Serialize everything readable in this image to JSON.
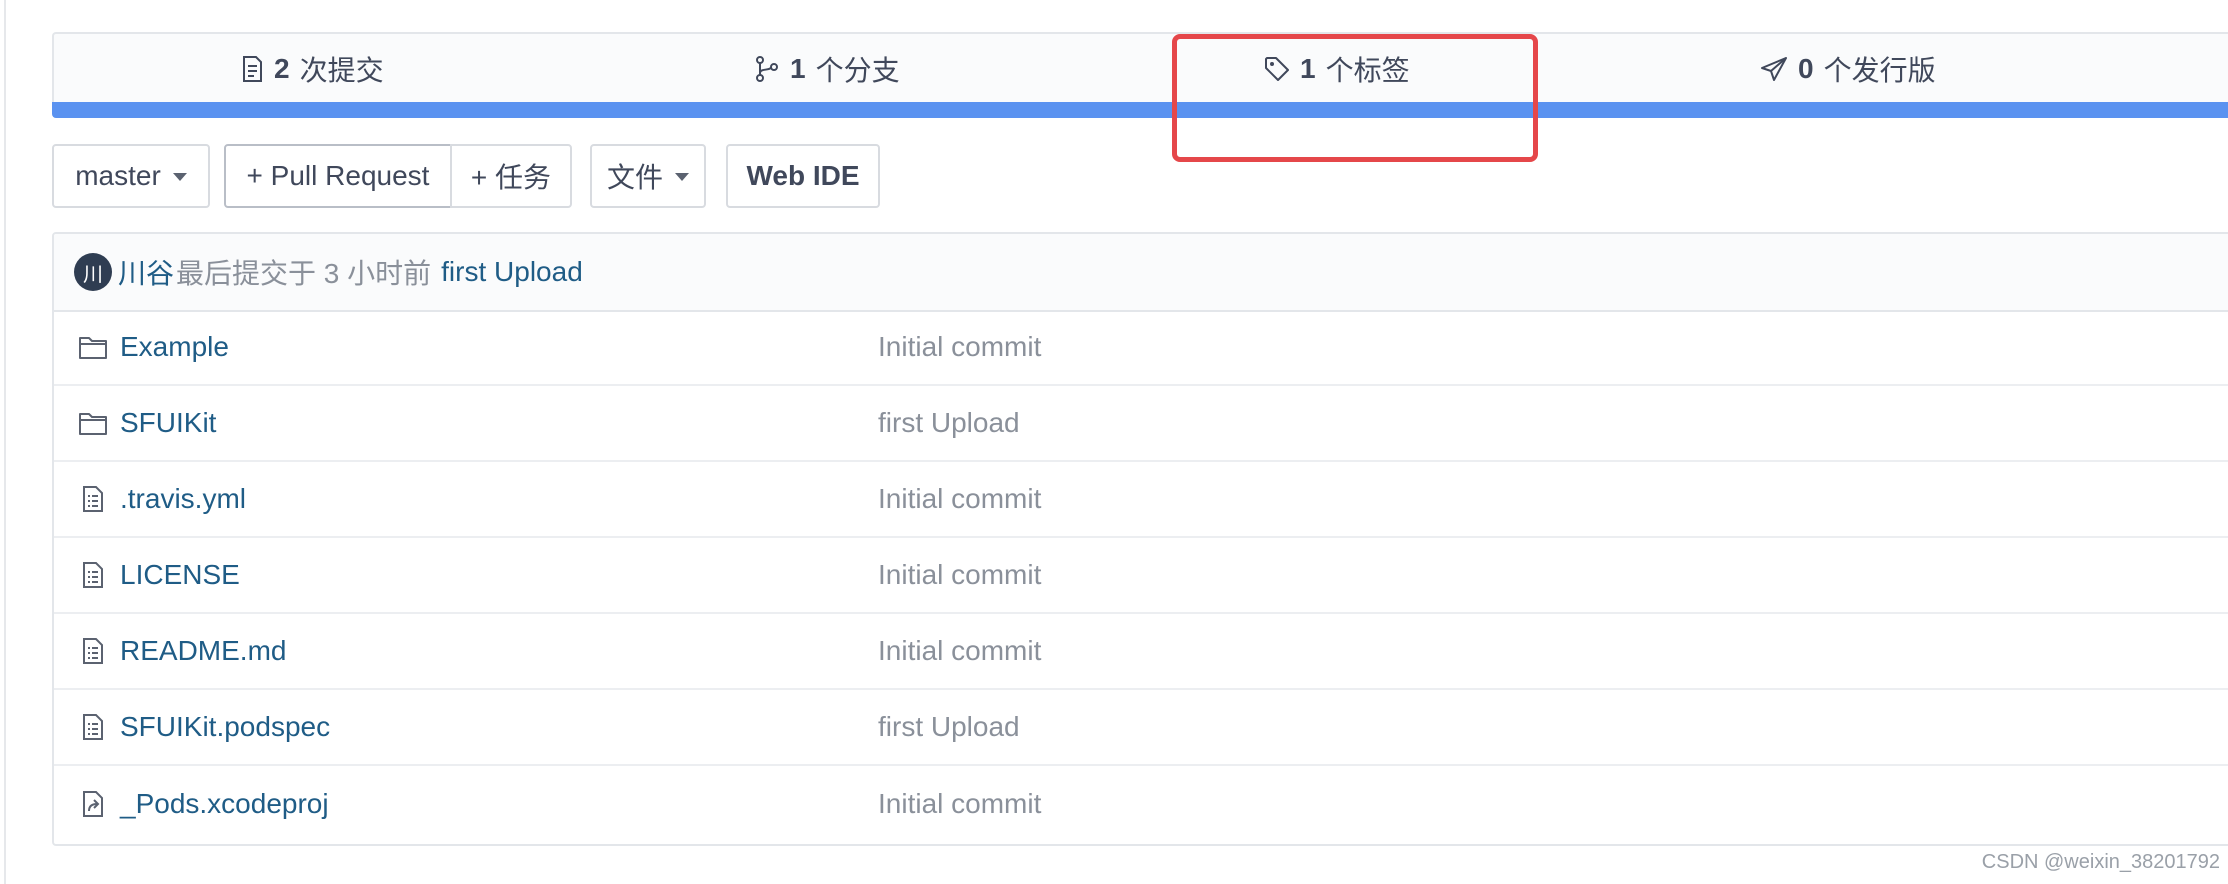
{
  "stats": {
    "commits": {
      "count": "2",
      "label": "次提交",
      "icon": "commit-icon"
    },
    "branches": {
      "count": "1",
      "label": "个分支",
      "icon": "branch-icon"
    },
    "tags": {
      "count": "1",
      "label": "个标签",
      "icon": "tag-icon"
    },
    "releases": {
      "count": "0",
      "label": "个发行版",
      "icon": "release-icon"
    }
  },
  "toolbar": {
    "branch": "master",
    "pull_request": "+ Pull Request",
    "task": "+ 任务",
    "file": "文件",
    "web_ide": "Web IDE"
  },
  "last_commit": {
    "avatar_initial": "川",
    "author": "川谷",
    "meta": "最后提交于 3 小时前",
    "message": "first Upload"
  },
  "files": [
    {
      "name": "Example",
      "type": "folder",
      "commit": "Initial commit"
    },
    {
      "name": "SFUIKit",
      "type": "folder",
      "commit": "first Upload"
    },
    {
      "name": ".travis.yml",
      "type": "file",
      "commit": "Initial commit"
    },
    {
      "name": "LICENSE",
      "type": "file",
      "commit": "Initial commit"
    },
    {
      "name": "README.md",
      "type": "file",
      "commit": "Initial commit"
    },
    {
      "name": "SFUIKit.podspec",
      "type": "file",
      "commit": "first Upload"
    },
    {
      "name": "_Pods.xcodeproj",
      "type": "symlink",
      "commit": "Initial commit"
    }
  ],
  "watermark": "CSDN @weixin_38201792",
  "colors": {
    "accent_bar": "#5a92f0",
    "highlight": "#e5474a",
    "link": "#1f5c86",
    "muted": "#8a909a"
  }
}
